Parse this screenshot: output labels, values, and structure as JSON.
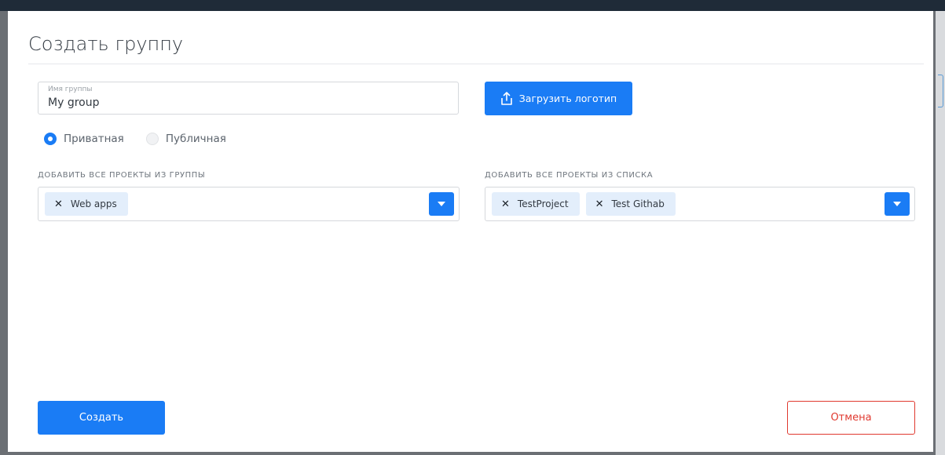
{
  "dialog": {
    "title": "Создать группу"
  },
  "name_field": {
    "label": "Имя группы",
    "value": "My group"
  },
  "upload_button": {
    "label": "Загрузить логотип",
    "icon": "upload-icon"
  },
  "visibility": {
    "selected": "Приватная",
    "options": [
      {
        "label": "Приватная",
        "checked": true
      },
      {
        "label": "Публичная",
        "checked": false
      }
    ]
  },
  "from_group": {
    "label": "ДОБАВИТЬ ВСЕ ПРОЕКТЫ ИЗ ГРУППЫ",
    "chips": [
      "Web apps"
    ]
  },
  "from_list": {
    "label": "ДОБАВИТЬ ВСЕ ПРОЕКТЫ ИЗ СПИСКА",
    "chips": [
      "TestProject",
      "Test Githab"
    ]
  },
  "actions": {
    "create_label": "Создать",
    "cancel_label": "Отмена"
  },
  "colors": {
    "accent": "#1a7cf5",
    "danger": "#e0392f",
    "chip_bg": "#e3eefb"
  }
}
